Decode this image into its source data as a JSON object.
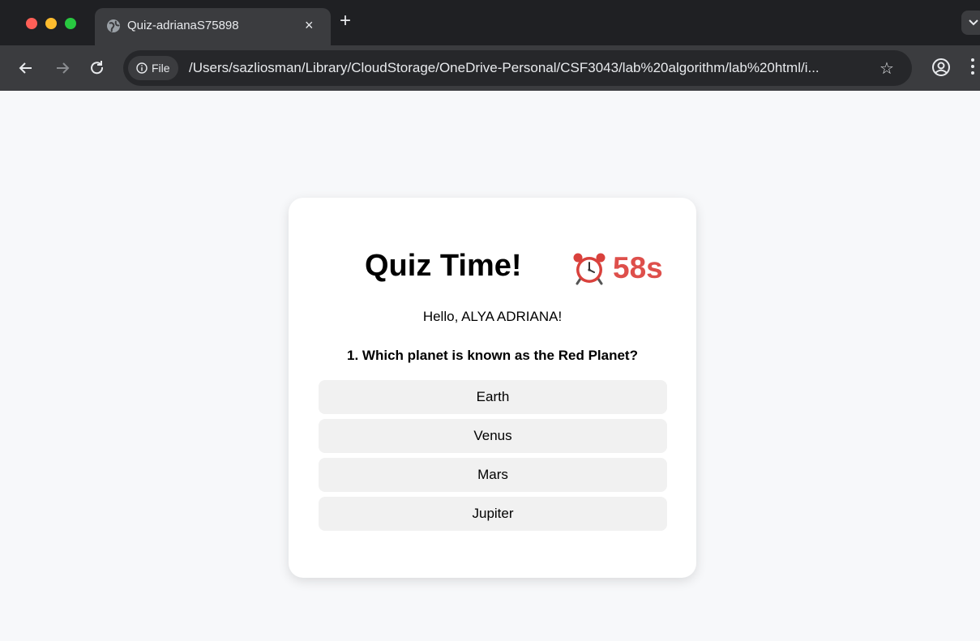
{
  "browser": {
    "tab_title": "Quiz-adrianaS75898",
    "tab_close": "×",
    "new_tab": "+",
    "chip_label": "File",
    "url": "/Users/sazliosman/Library/CloudStorage/OneDrive-Personal/CSF3043/lab%20algorithm/lab%20html/i...",
    "star": "☆"
  },
  "quiz": {
    "title": "Quiz Time!",
    "timer": "58s",
    "greeting": "Hello, ALYA ADRIANA!",
    "question": "1. Which planet is known as the Red Planet?",
    "options": [
      "Earth",
      "Venus",
      "Mars",
      "Jupiter"
    ]
  },
  "colors": {
    "timer": "#de4f4b",
    "option_bg": "#f1f1f1",
    "page_bg": "#f7f8fa"
  }
}
